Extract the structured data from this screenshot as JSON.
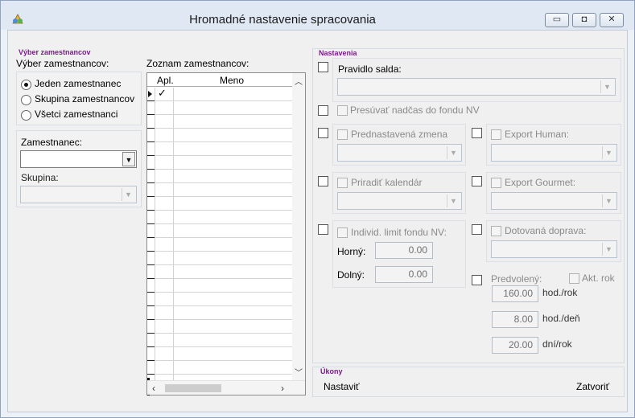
{
  "window": {
    "title": "Hromadné nastavenie spracovania"
  },
  "left": {
    "group_title": "Výber zamestnancov",
    "selection_label": "Výber zamestnancov:",
    "radios": [
      {
        "label": "Jeden zamestnanec",
        "selected": true
      },
      {
        "label": "Skupina zamestnancov",
        "selected": false
      },
      {
        "label": "Všetci zamestnanci",
        "selected": false
      }
    ],
    "employee_label": "Zamestnanec:",
    "employee_value": "",
    "group_label": "Skupina:",
    "group_value": ""
  },
  "list": {
    "label": "Zoznam zamestnancov:",
    "columns": [
      "Apl.",
      "Meno"
    ],
    "rows": [
      {
        "apl": true,
        "meno": ""
      }
    ]
  },
  "settings": {
    "group_title": "Nastavenia",
    "pravidlo_salda": "Pravidlo salda:",
    "presuvat": "Presúvať nadčas do fondu NV",
    "prednastavena_zmena": "Prednastavená zmena",
    "export_human": "Export Human:",
    "priradit_kalendar": "Priradiť kalendár",
    "export_gourmet": "Export Gourmet:",
    "individ_limit": "Individ. limit fondu NV:",
    "horny_label": "Horný:",
    "horny_value": "0.00",
    "dolny_label": "Dolný:",
    "dolny_value": "0.00",
    "dotovana_doprava": "Dotovaná doprava:",
    "predvoleny": "Predvolený:",
    "akt_rok": "Akt. rok",
    "hod_rok_value": "160.00",
    "hod_rok_unit": "hod./rok",
    "hod_den_value": "8.00",
    "hod_den_unit": "hod./deň",
    "dni_rok_value": "20.00",
    "dni_rok_unit": "dní/rok"
  },
  "actions": {
    "group_title": "Úkony",
    "nastavit": "Nastaviť",
    "zatvorit": "Zatvoriť"
  }
}
